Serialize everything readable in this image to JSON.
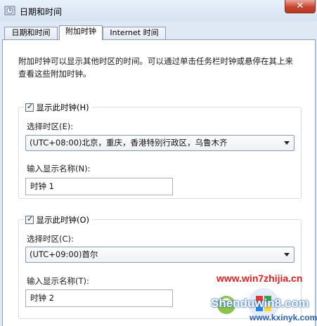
{
  "window": {
    "title": "日期和时间",
    "close_glyph": "✕"
  },
  "tabs": [
    {
      "label": "日期和时间"
    },
    {
      "label": "附加时钟"
    },
    {
      "label": "Internet 时间"
    }
  ],
  "description": "附加时钟可以显示其他时区的时间。可以通过单击任务栏时钟或悬停在其上来查看这些附加时钟。",
  "clock1": {
    "checkbox_label": "显示此时钟(H)",
    "checked": true,
    "timezone_label": "选择时区(E):",
    "timezone_value": "(UTC+08:00)北京，重庆，香港特别行政区，乌鲁木齐",
    "name_label": "输入显示名称(N):",
    "name_value": "时钟 1"
  },
  "clock2": {
    "checkbox_label": "显示此时钟(O)",
    "checked": true,
    "timezone_label": "选择时区(C):",
    "timezone_value": "(UTC+09:00)首尔",
    "name_label": "输入显示名称(T):",
    "name_value": "时钟 2"
  },
  "watermark": {
    "url": "www.win7zhijia.cn",
    "brand": "Shenduwin8.com",
    "site": "www.kxinyk.com"
  }
}
